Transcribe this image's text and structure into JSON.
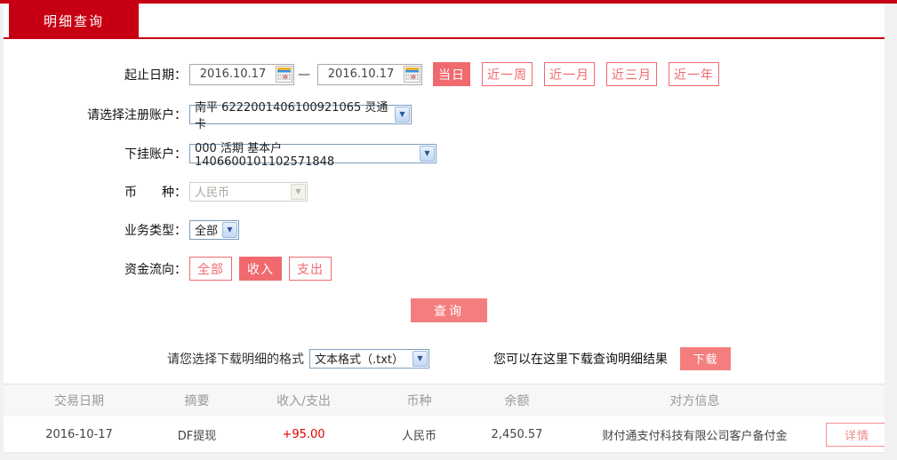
{
  "colors": {
    "accent-red": "#c60012",
    "salmon": "#f0696e",
    "salmon-light": "#f47e7e",
    "amount-red": "#e00000"
  },
  "tab": {
    "label": "明细查询"
  },
  "form": {
    "date_range": {
      "label": "起止日期：",
      "start_value": "2016.10.17",
      "end_value": "2016.10.17",
      "separator": "—"
    },
    "quick_ranges": [
      {
        "label": "当日",
        "active": true
      },
      {
        "label": "近一周",
        "active": false
      },
      {
        "label": "近一月",
        "active": false
      },
      {
        "label": "近三月",
        "active": false
      },
      {
        "label": "近一年",
        "active": false
      }
    ],
    "register_account": {
      "label": "请选择注册账户：",
      "value": "南平 6222001406100921065 灵通卡"
    },
    "sub_account": {
      "label": "下挂账户：",
      "value": "000 活期 基本户 1406600101102571848"
    },
    "currency": {
      "label": "币　　种：",
      "value": "人民币",
      "disabled": true
    },
    "business_type": {
      "label": "业务类型：",
      "value": "全部"
    },
    "fund_flow": {
      "label": "资金流向：",
      "options": [
        {
          "label": "全部",
          "active": false
        },
        {
          "label": "收入",
          "active": true
        },
        {
          "label": "支出",
          "active": false
        }
      ]
    },
    "query_button": "查询"
  },
  "download": {
    "format_label": "请您选择下载明细的格式",
    "format_value": "文本格式（.txt）",
    "hint": "您可以在这里下载查询明细结果",
    "button": "下载"
  },
  "table": {
    "headers": [
      "交易日期",
      "摘要",
      "收入/支出",
      "币种",
      "余额",
      "对方信息"
    ],
    "rows": [
      {
        "date": "2016-10-17",
        "summary": "DF提现",
        "amount": "+95.00",
        "currency": "人民币",
        "balance": "2,450.57",
        "counterparty": "财付通支付科技有限公司客户备付金",
        "action": "详情"
      }
    ]
  }
}
